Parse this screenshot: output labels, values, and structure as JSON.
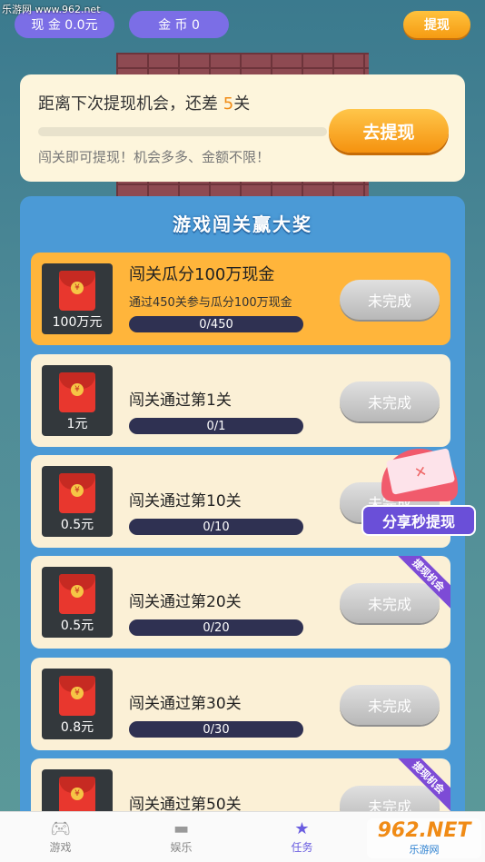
{
  "watermark": "乐游网 www.962.net",
  "topbar": {
    "cash": "现 金 0.0元",
    "coins": "金 币 0",
    "withdraw": "提现"
  },
  "next_chance": {
    "title_prefix": "距离下次提现机会，还差 ",
    "remaining": "5",
    "title_suffix": "关",
    "subtitle": "闯关即可提现！机会多多、金额不限！",
    "button": "去提现"
  },
  "panel": {
    "title": "游戏闯关赢大奖",
    "tasks": [
      {
        "amount": "100万元",
        "title": "闯关瓜分100万现金",
        "desc": "通过450关参与瓜分100万现金",
        "progress": "0/450",
        "status": "未完成",
        "ribbon": ""
      },
      {
        "amount": "1元",
        "title": "闯关通过第1关",
        "desc": "",
        "progress": "0/1",
        "status": "未完成",
        "ribbon": ""
      },
      {
        "amount": "0.5元",
        "title": "闯关通过第10关",
        "desc": "",
        "progress": "0/10",
        "status": "未完成",
        "ribbon": ""
      },
      {
        "amount": "0.5元",
        "title": "闯关通过第20关",
        "desc": "",
        "progress": "0/20",
        "status": "未完成",
        "ribbon": "提现机会"
      },
      {
        "amount": "0.8元",
        "title": "闯关通过第30关",
        "desc": "",
        "progress": "0/30",
        "status": "未完成",
        "ribbon": ""
      },
      {
        "amount": "",
        "title": "闯关通过第50关",
        "desc": "",
        "progress": "",
        "status": "未完成",
        "ribbon": "提现机会"
      }
    ]
  },
  "share": {
    "label": "分享秒提现"
  },
  "nav": {
    "items": [
      {
        "label": "游戏",
        "icon": "gamepad-icon"
      },
      {
        "label": "娱乐",
        "icon": "video-icon"
      },
      {
        "label": "任务",
        "icon": "star-icon"
      },
      {
        "label": "",
        "icon": ""
      }
    ],
    "active": "任务"
  },
  "logo": {
    "big": "962.NET",
    "small": "乐游网"
  },
  "colors": {
    "accent_orange": "#f5920f",
    "purple": "#7b6ee6",
    "panel_blue": "#4b9ad6"
  }
}
